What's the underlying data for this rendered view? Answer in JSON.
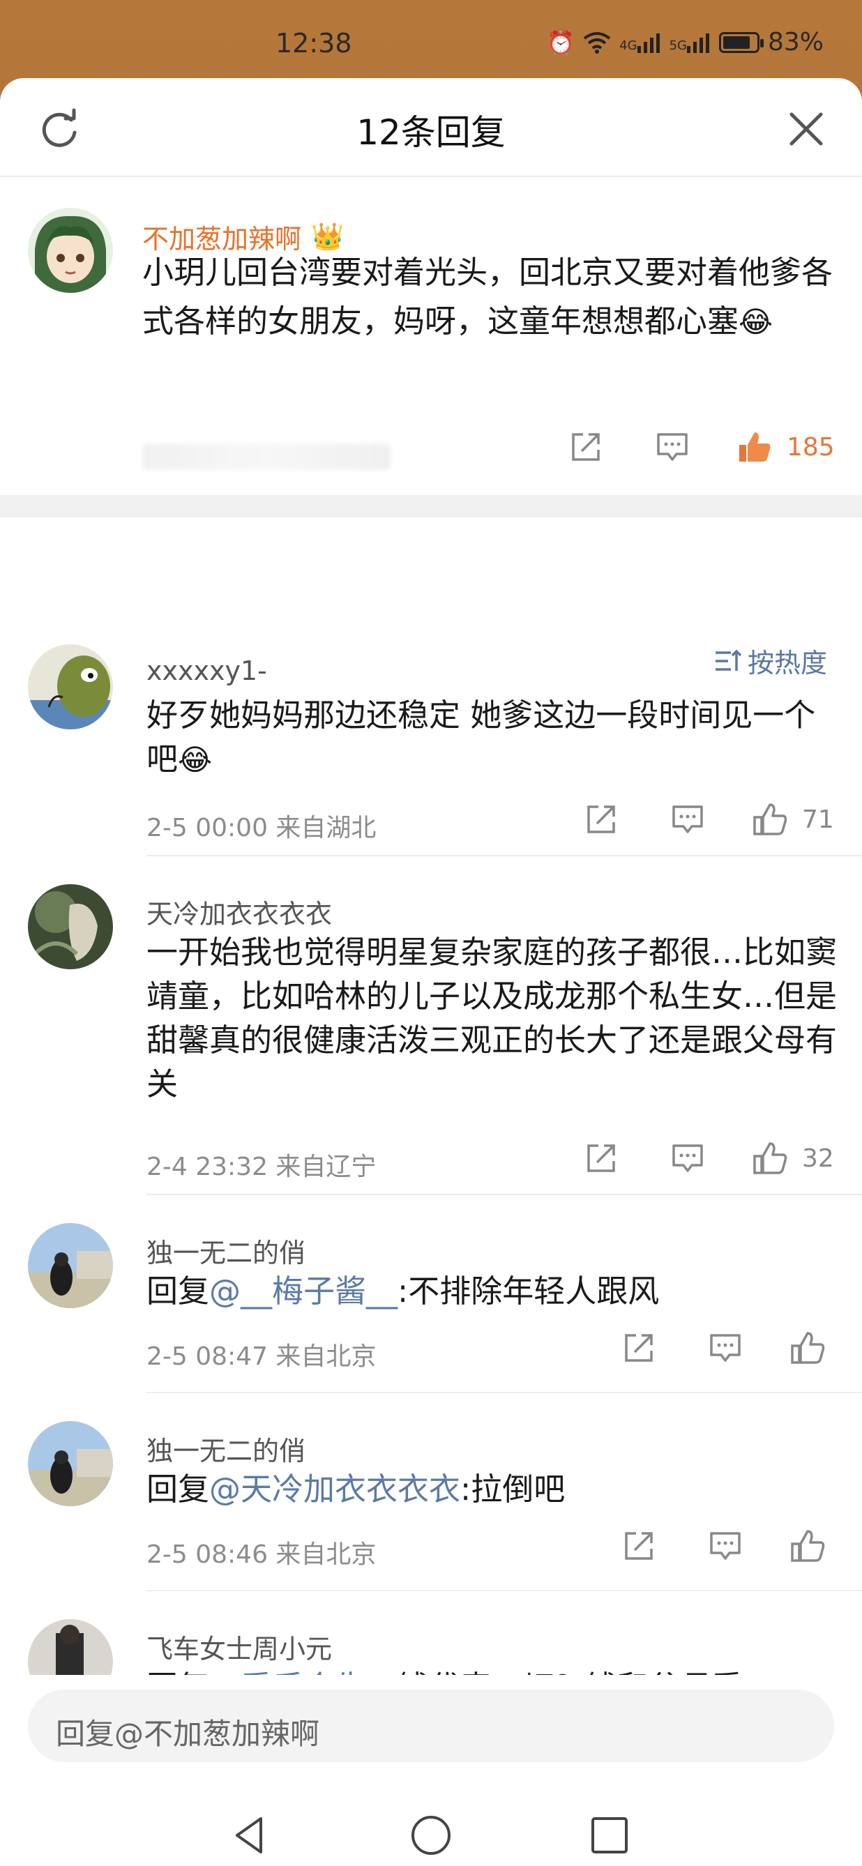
{
  "status_bar": {
    "time": "12:38",
    "network1": "4G",
    "network2": "5G",
    "battery": "83%",
    "battery_level": 0.83
  },
  "header": {
    "title": "12条回复",
    "refresh_icon": "refresh-icon",
    "close_icon": "close-icon"
  },
  "root_comment": {
    "author": "不加葱加辣啊",
    "text_before_emoji": "小玥儿回台湾要对着光头，回北京又要对着他爹各式各样的女朋友，妈呀，这童年想想都心塞",
    "emoji": "😂",
    "likes": "185"
  },
  "sort_label": "按热度",
  "replies": [
    {
      "author": "xxxxxy1-",
      "text": "好歹她妈妈那边还稳定 她爹这边一段时间见一个吧",
      "emoji": "😂",
      "meta": "2-5 00:00 来自湖北",
      "likes": "71"
    },
    {
      "author": "天冷加衣衣衣衣",
      "text": "一开始我也觉得明星复杂家庭的孩子都很…比如窦靖童，比如哈林的儿子以及成龙那个私生女…但是甜馨真的很健康活泼三观正的长大了还是跟父母有关",
      "meta": "2-4 23:32 来自辽宁",
      "likes": "32"
    },
    {
      "author": "独一无二的俏",
      "prefix": "回复",
      "mention": "@__梅子酱__",
      "text": ":不排除年轻人跟风",
      "meta": "2-5 08:47 来自北京",
      "likes": ""
    },
    {
      "author": "独一无二的俏",
      "prefix": "回复",
      "mention": "@天冷加衣衣衣衣",
      "text": ":拉倒吧",
      "meta": "2-5 08:46 来自北京",
      "likes": ""
    },
    {
      "author": "飞车女士周小元",
      "prefix": "回复",
      "mention": "@爱后合生…",
      "text": "钱代表…切？钱和父母爱"
    }
  ],
  "input": {
    "placeholder": "回复@不加葱加辣啊"
  },
  "colors": {
    "accent": "#e8763a",
    "link": "#5a7aa8"
  }
}
